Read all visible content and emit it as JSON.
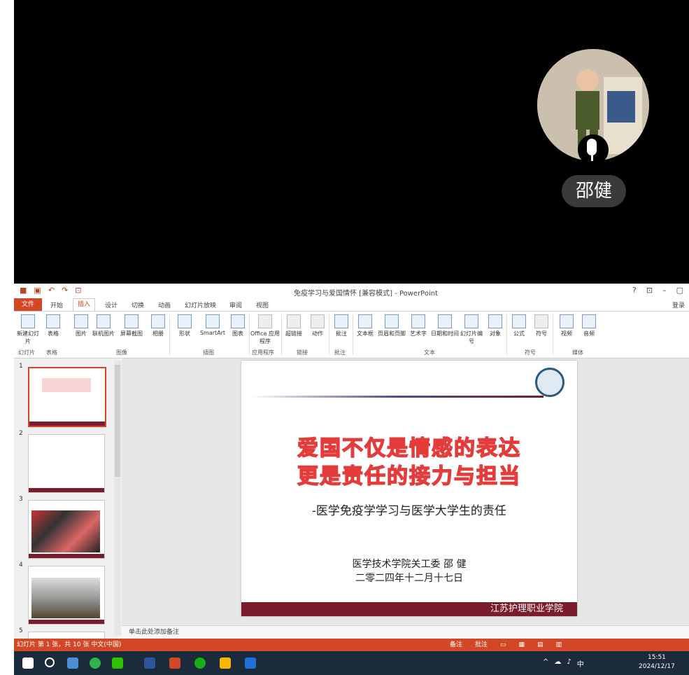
{
  "meeting": {
    "participant_name": "邵健",
    "icons": [
      "mic-icon",
      "avatar"
    ]
  },
  "powerpoint": {
    "window_title": "免疫学习与爱国情怀 [兼容模式] - PowerPoint",
    "window_controls": [
      "?",
      "⊡",
      "–",
      "▢"
    ],
    "tabs": [
      "文件",
      "开始",
      "插入",
      "设计",
      "切换",
      "动画",
      "幻灯片放映",
      "审阅",
      "视图"
    ],
    "active_tab": "插入",
    "login": "登录",
    "ribbon": {
      "buttons": [
        "新建幻灯片",
        "表格",
        "图片",
        "联机图片",
        "屏幕截图",
        "相册",
        "形状",
        "SmartArt",
        "图表",
        "Office 应用程序",
        "超链接",
        "动作",
        "批注",
        "文本框",
        "页眉和页脚",
        "艺术字",
        "日期和时间",
        "幻灯片编号",
        "对象",
        "公式",
        "符号",
        "视频",
        "音频"
      ],
      "groups": [
        "幻灯片",
        "表格",
        "图像",
        "插图",
        "应用程序",
        "链接",
        "批注",
        "文本",
        "符号",
        "媒体"
      ]
    },
    "thumbnails": [
      "1",
      "2",
      "3",
      "4",
      "5"
    ],
    "slide": {
      "title_line1": "爱国不仅是情感的表达",
      "title_line2": "更是责任的接力与担当",
      "subtitle": "-医学免疫学学习与医学大学生的责任",
      "author_line1": "医学技术学院关工委    邵  健",
      "author_line2": "二零二四年十二月十七日",
      "footer": "江苏护理职业学院"
    },
    "notes_placeholder": "单击此处添加备注",
    "status_left": "幻灯片 第 1 张，共 10 张    中文(中国)",
    "status_right": [
      "备注",
      "批注"
    ],
    "colors": {
      "accent": "#d24726",
      "slide_band": "#7a1c2b",
      "headline_stroke": "#e43b3b"
    }
  },
  "taskbar": {
    "tray": [
      "^",
      "中"
    ],
    "time": "15:51",
    "date": "2024/12/17"
  }
}
